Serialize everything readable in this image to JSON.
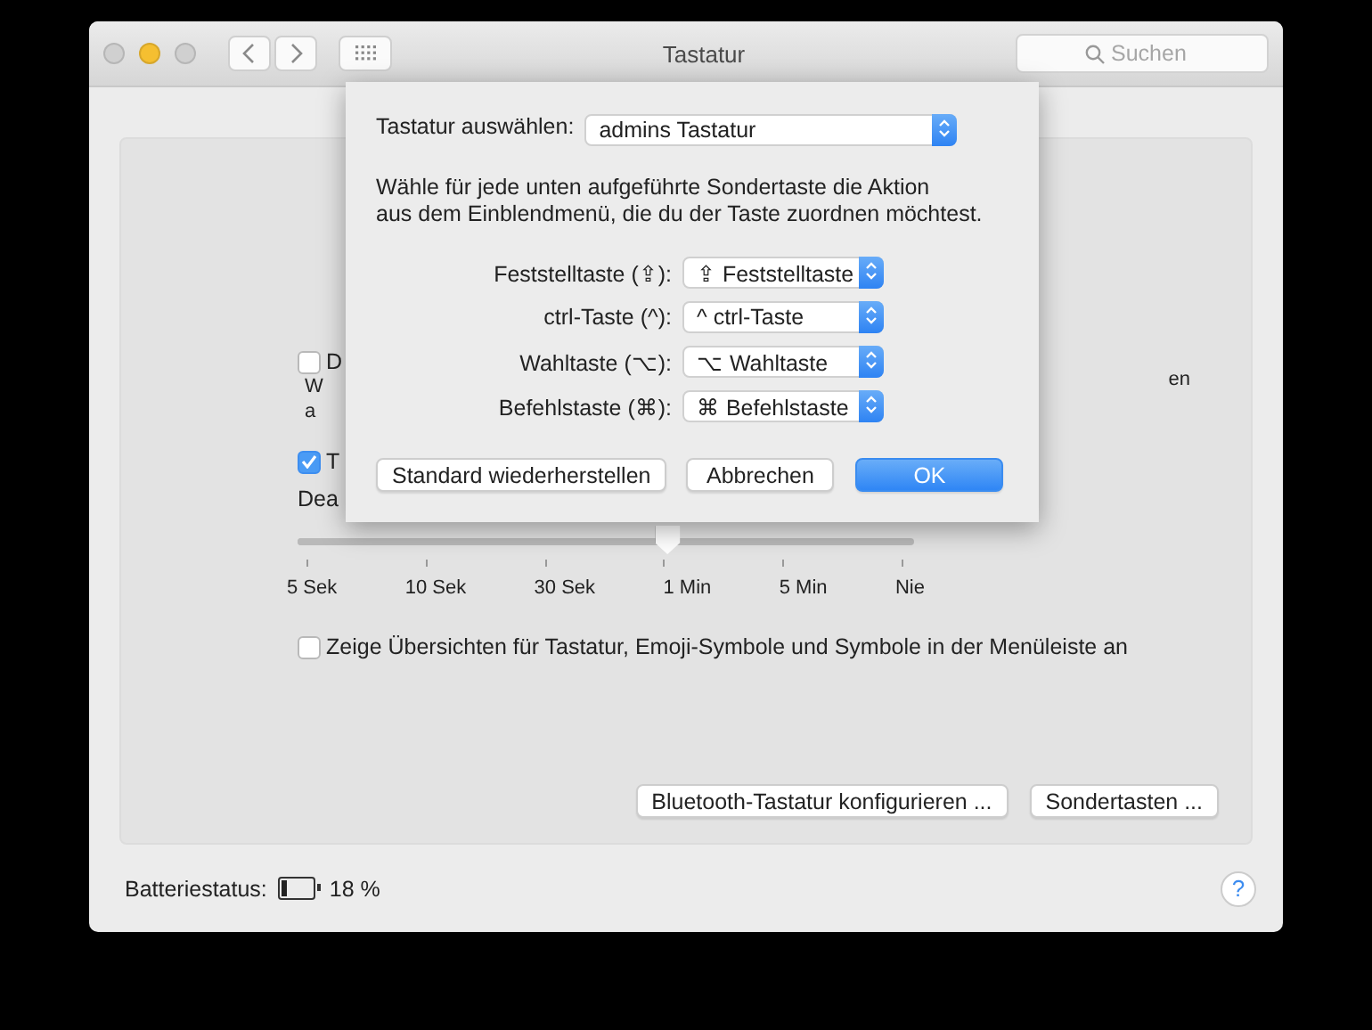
{
  "window": {
    "title": "Tastatur",
    "search": {
      "placeholder": "Suchen"
    }
  },
  "panel": {
    "partial_checkbox": {
      "label": "D",
      "checked": false
    },
    "partial_lines": [
      "W",
      "a"
    ],
    "partial_right": "en",
    "backlight_checkbox": {
      "label": "T",
      "checked": true
    },
    "partial_label": "Dea",
    "slider": {
      "level": 0.6,
      "ticks": [
        "5 Sek",
        "10 Sek",
        "30 Sek",
        "1 Min",
        "5 Min",
        "Nie"
      ]
    },
    "menu_checkbox": {
      "label": "Zeige Übersichten für Tastatur, Emoji-Symbole und Symbole in der Menüleiste an",
      "checked": false
    },
    "buttons": [
      "Bluetooth-Tastatur konfigurieren ...",
      "Sondertasten ..."
    ]
  },
  "battery": {
    "label": "Batteriestatus:",
    "level": 0.18,
    "reading": "18 %"
  },
  "help": "?",
  "sheet": {
    "keyboard_label": "Tastatur auswählen:",
    "keyboard_value": "admins Tastatur",
    "description": "Wähle für jede unten aufgeführte Sondertaste die Aktion\naus dem Einblendmenü, die du der Taste zuordnen möchtest.",
    "modifiers": [
      {
        "label": "Feststelltaste (⇪):",
        "value": "⇪ Feststelltaste"
      },
      {
        "label": "ctrl-Taste (^):",
        "value": "^ ctrl-Taste"
      },
      {
        "label": "Wahltaste (⌥):",
        "value": "⌥ Wahltaste"
      },
      {
        "label": "Befehlstaste (⌘):",
        "value": "⌘ Befehlstaste"
      }
    ],
    "buttons": [
      {
        "label": "Standard wiederherstellen",
        "default": false
      },
      {
        "label": "Abbrechen",
        "default": false
      },
      {
        "label": "OK",
        "default": true
      }
    ]
  }
}
